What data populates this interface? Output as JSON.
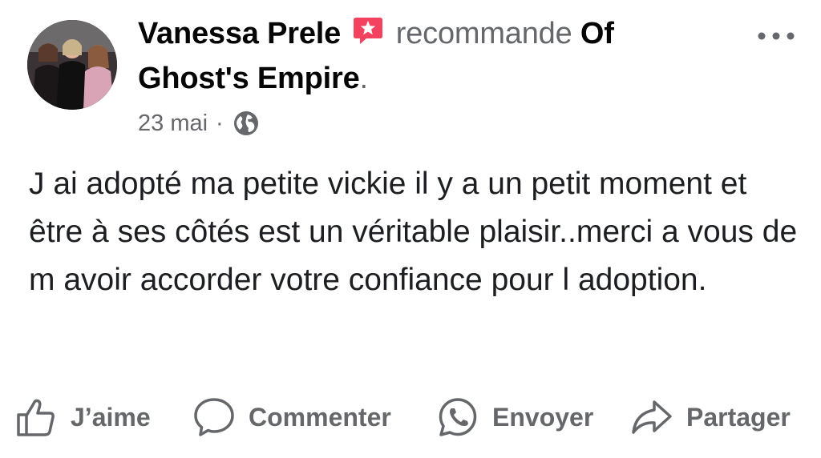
{
  "post": {
    "author": "Vanessa Prele",
    "verb": "recommande",
    "page": "Of Ghost's Empire",
    "period": ".",
    "date": "23 mai",
    "separator": "·",
    "privacy_icon": "globe-icon",
    "recommend_icon": "recommend-star-icon",
    "body": "J ai adopté ma petite vickie il y a un petit moment et être à ses côtés est un véritable plaisir..merci a vous de m avoir accorder votre confiance pour l adoption."
  },
  "actions": {
    "like": {
      "label": "J’aime",
      "icon": "thumbs-up-icon"
    },
    "comment": {
      "label": "Commenter",
      "icon": "comment-bubble-icon"
    },
    "send": {
      "label": "Envoyer",
      "icon": "whatsapp-icon"
    },
    "share": {
      "label": "Partager",
      "icon": "share-arrow-icon"
    }
  },
  "colors": {
    "primary_text": "#050505",
    "secondary_text": "#65676b",
    "recommend_badge": "#f3425f"
  }
}
